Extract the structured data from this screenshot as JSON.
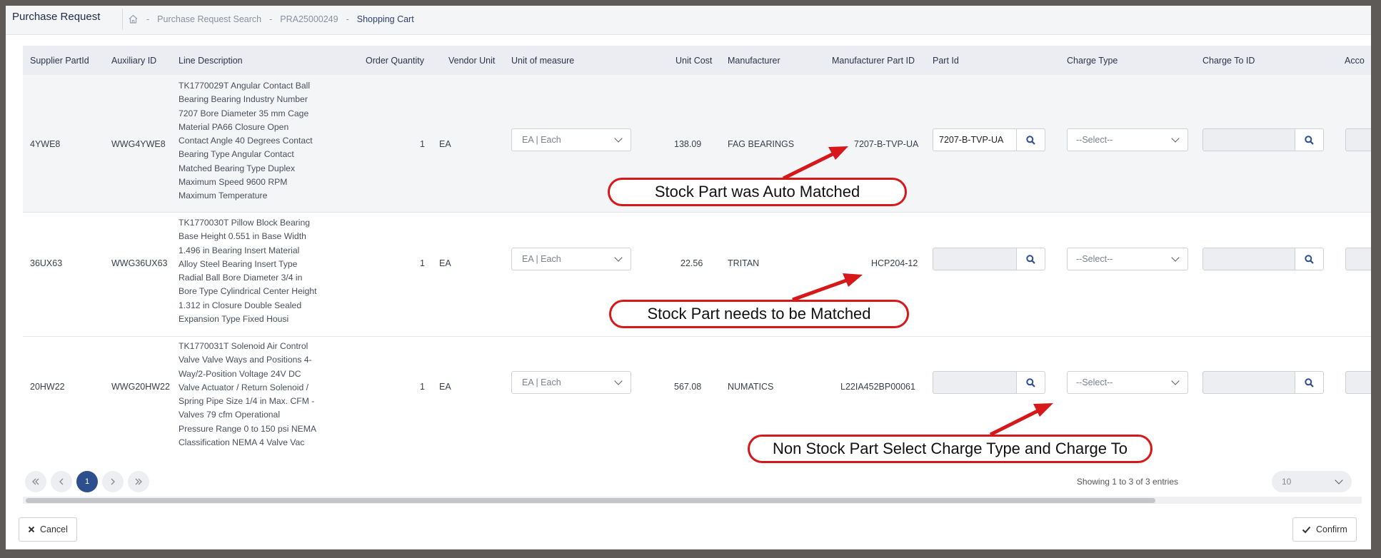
{
  "app": {
    "title": "Purchase Request"
  },
  "breadcrumb": {
    "home_icon": "home-icon",
    "sep": "-",
    "items": [
      "Purchase Request Search",
      "PRA25000249",
      "Shopping Cart"
    ]
  },
  "table": {
    "columns": [
      "Supplier PartId",
      "Auxiliary ID",
      "Line Description",
      "Order Quantity",
      "Vendor Unit",
      "Unit of measure",
      "Unit Cost",
      "Manufacturer",
      "Manufacturer Part ID",
      "Part Id",
      "Charge Type",
      "Charge To ID",
      "Acco"
    ],
    "rows": [
      {
        "supplier_part_id": "4YWE8",
        "auxiliary_id": "WWG4YWE8",
        "description_lines": [
          "TK1770029T Angular Contact Ball",
          "Bearing Bearing Industry Number",
          "7207 Bore Diameter 35 mm Cage",
          "Material PA66 Closure Open",
          "Contact Angle 40 Degrees Contact",
          "Bearing Type Angular Contact",
          "Matched Bearing Type Duplex",
          "Maximum Speed 9600 RPM",
          "Maximum Temperature"
        ],
        "order_quantity": "1",
        "vendor_unit": "EA",
        "unit_of_measure": "EA | Each",
        "unit_cost": "138.09",
        "manufacturer": "FAG BEARINGS",
        "manufacturer_part_id": "7207-B-TVP-UA",
        "part_id": "7207-B-TVP-UA",
        "charge_type": "--Select--",
        "charge_to_id": ""
      },
      {
        "supplier_part_id": "36UX63",
        "auxiliary_id": "WWG36UX63",
        "description_lines": [
          "TK1770030T Pillow Block Bearing",
          "Base Height 0.551 in Base Width",
          "1.496 in Bearing Insert Material",
          "Alloy Steel Bearing Insert Type",
          "Radial Ball Bore Diameter 3/4 in",
          "Bore Type Cylindrical Center Height",
          "1.312 in Closure Double Sealed",
          "Expansion Type Fixed Housi"
        ],
        "order_quantity": "1",
        "vendor_unit": "EA",
        "unit_of_measure": "EA | Each",
        "unit_cost": "22.56",
        "manufacturer": "TRITAN",
        "manufacturer_part_id": "HCP204-12",
        "part_id": "",
        "charge_type": "--Select--",
        "charge_to_id": ""
      },
      {
        "supplier_part_id": "20HW22",
        "auxiliary_id": "WWG20HW22",
        "description_lines": [
          "TK1770031T Solenoid Air Control",
          "Valve Valve Ways and Positions 4-",
          "Way/2-Position Voltage 24V DC",
          "Valve Actuator / Return Solenoid /",
          "Spring Pipe Size 1/4 in Max. CFM -",
          "Valves 79 cfm Operational",
          "Pressure Range 0 to 150 psi NEMA",
          "Classification NEMA 4 Valve Vac"
        ],
        "order_quantity": "1",
        "vendor_unit": "EA",
        "unit_of_measure": "EA | Each",
        "unit_cost": "567.08",
        "manufacturer": "NUMATICS",
        "manufacturer_part_id": "L22IA452BP00061",
        "part_id": "",
        "charge_type": "--Select--",
        "charge_to_id": ""
      }
    ]
  },
  "callouts": [
    "Stock Part was Auto Matched",
    "Stock Part needs to be Matched",
    "Non Stock Part Select Charge Type and Charge To"
  ],
  "pagination": {
    "current_page": "1",
    "showing": "Showing 1 to 3 of 3 entries",
    "page_size": "10"
  },
  "footer": {
    "cancel_label": "Cancel",
    "confirm_label": "Confirm"
  },
  "colors": {
    "annotation_red": "#d6181b",
    "accent_blue": "#2d4f8e",
    "header_bg": "#ecedf3"
  }
}
